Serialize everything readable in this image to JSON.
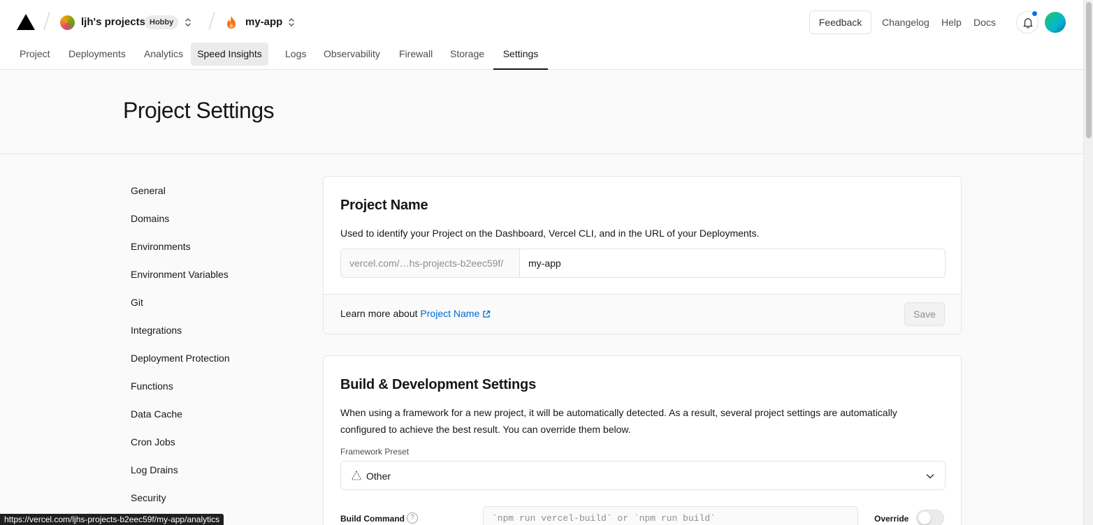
{
  "header": {
    "team_name": "ljh's projects",
    "team_plan": "Hobby",
    "project_name": "my-app",
    "feedback_label": "Feedback",
    "links": [
      "Changelog",
      "Help",
      "Docs"
    ],
    "notification_dot_color": "#0a72ef"
  },
  "tabs": [
    "Project",
    "Deployments",
    "Analytics",
    "Speed Insights",
    "Logs",
    "Observability",
    "Firewall",
    "Storage",
    "Settings"
  ],
  "active_tab": "Settings",
  "hovered_tab": "Speed Insights",
  "page": {
    "title": "Project Settings"
  },
  "sidebar": {
    "items": [
      "General",
      "Domains",
      "Environments",
      "Environment Variables",
      "Git",
      "Integrations",
      "Deployment Protection",
      "Functions",
      "Data Cache",
      "Cron Jobs",
      "Log Drains",
      "Security"
    ]
  },
  "project_name_card": {
    "title": "Project Name",
    "description": "Used to identify your Project on the Dashboard, Vercel CLI, and in the URL of your Deployments.",
    "url_prefix": "vercel.com/…hs-projects-b2eec59f/",
    "value": "my-app",
    "learn_more_text": "Learn more about",
    "learn_more_link": "Project Name",
    "save_label": "Save"
  },
  "build_card": {
    "title": "Build & Development Settings",
    "description_line1": "When using a framework for a new project, it will be automatically detected. As a result, several project settings are automatically",
    "description_line2": "configured to achieve the best result. You can override them below.",
    "framework_label": "Framework Preset",
    "framework_value": "Other",
    "build_command_label": "Build Command",
    "build_command_placeholder": "`npm run vercel-build` or `npm run build`",
    "override_label": "Override",
    "override_enabled": false
  },
  "status_bar_url": "https://vercel.com/ljhs-projects-b2eec59f/my-app/analytics",
  "colors": {
    "link": "#0068d6",
    "accent_dark": "#171717",
    "border": "#e5e5e5"
  }
}
